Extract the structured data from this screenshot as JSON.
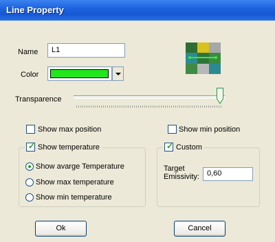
{
  "window": {
    "title": "Line Property"
  },
  "name_field": {
    "label": "Name",
    "value": "L1"
  },
  "color_field": {
    "label": "Color",
    "value": "#22e61e"
  },
  "transparence": {
    "label": "Transparence",
    "level": 0.97
  },
  "show_max_position": {
    "label": "Show max position",
    "checked": false
  },
  "show_min_position": {
    "label": "Show min position",
    "checked": false
  },
  "show_temperature": {
    "label": "Show temperature",
    "checked": true,
    "options": [
      {
        "label": "Show avarge Temperature",
        "selected": true
      },
      {
        "label": "Show max temperature",
        "selected": false
      },
      {
        "label": "Show min temperature",
        "selected": false
      }
    ]
  },
  "custom": {
    "label": "Custom",
    "checked": true,
    "emissivity_label_1": "Target",
    "emissivity_label_2": "Emissivity:",
    "emissivity_value": "0,60"
  },
  "buttons": {
    "ok": "Ok",
    "cancel": "Cancel"
  },
  "preview_icon": "line-preview-icon"
}
